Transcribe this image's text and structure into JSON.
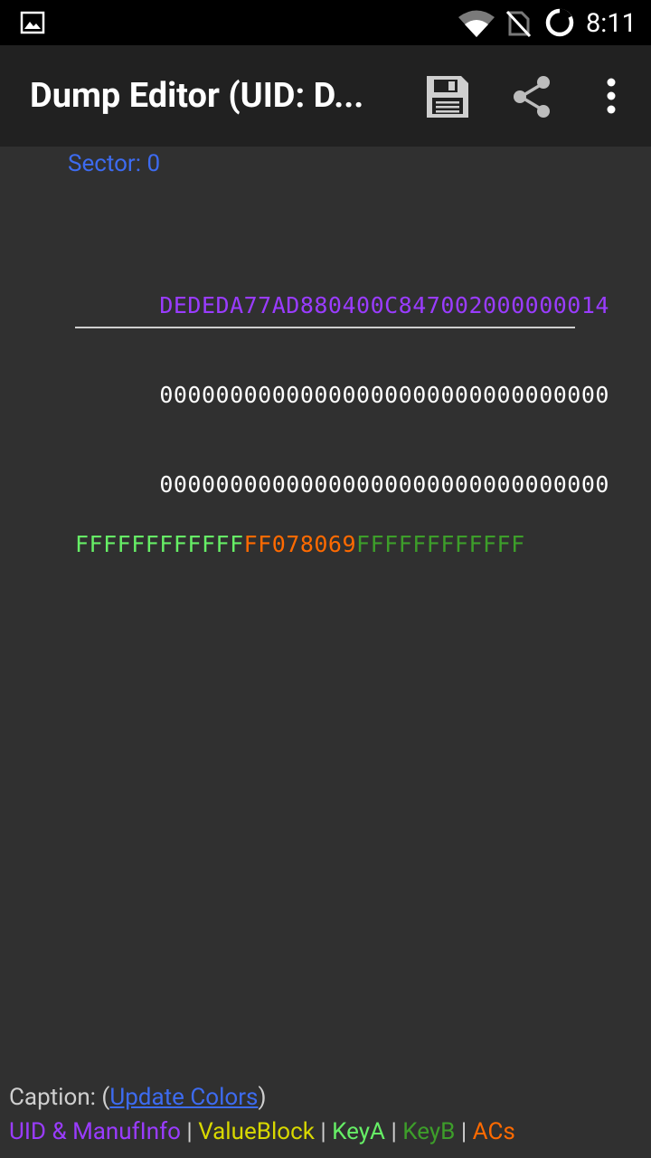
{
  "status_bar": {
    "time": "8:11",
    "icons": [
      "gallery-notification-icon",
      "wifi-icon",
      "no-sim-icon",
      "battery-loading-icon"
    ]
  },
  "app_bar": {
    "title": "Dump Editor (UID: D...",
    "actions": [
      "save-icon",
      "share-icon",
      "more-vert-icon"
    ]
  },
  "sector": {
    "label": "Sector: 0",
    "rows": [
      [
        {
          "text": "DEDEDA77AD880400C847002000000014",
          "kind": "uid"
        }
      ],
      [
        {
          "text": "00000000000000000000000000000000",
          "kind": "plain"
        }
      ],
      [
        {
          "text": "00000000000000000000000000000000",
          "kind": "plain"
        }
      ],
      [
        {
          "text": "FFFFFFFFFFFF",
          "kind": "keya"
        },
        {
          "text": "FF078069",
          "kind": "acs"
        },
        {
          "text": "FFFFFFFFFFFF",
          "kind": "keyb"
        }
      ]
    ]
  },
  "caption": {
    "prefix": "Caption: (",
    "link": "Update Colors",
    "suffix": ")"
  },
  "legend": {
    "uid": "UID & ManufInfo",
    "value_block": "ValueBlock",
    "key_a": "KeyA",
    "key_b": "KeyB",
    "acs": "ACs",
    "separator": " | "
  },
  "colors": {
    "uid": "#9a3cff",
    "value_block": "#d8d800",
    "key_a": "#66ee66",
    "key_b": "#3d9e2a",
    "acs": "#ff6a00",
    "link": "#3d6bf0",
    "background": "#303030",
    "appbar": "#212121"
  }
}
